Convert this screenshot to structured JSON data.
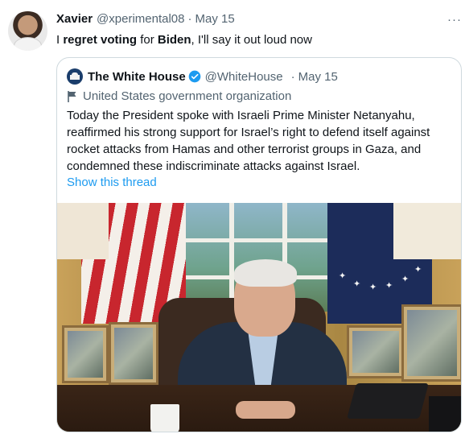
{
  "tweet": {
    "author_name": "Xavier",
    "author_handle": "@xperimental08",
    "separator": "·",
    "date": "May 15",
    "more_label": "···",
    "text_parts": [
      "I ",
      "regret voting",
      " for ",
      "Biden",
      ", I'll say it out loud now"
    ]
  },
  "quote": {
    "author_name": "The White House",
    "author_handle": "@WhiteHouse",
    "separator": "·",
    "date": "May 15",
    "org_label": "United States government organization",
    "text_lines": [
      "Today the President spoke with Israeli Prime Minister Netanyahu,",
      "reaffirmed his strong support for Israel’s right to defend itself against",
      "rocket attacks from Hamas and other terrorist groups in Gaza, and",
      "condemned these indiscriminate attacks against Israel."
    ],
    "show_thread": "Show this thread"
  },
  "colors": {
    "link": "#1d9bf0",
    "secondary_text": "#536471",
    "border": "#cfd9de"
  },
  "icons": [
    "avatar",
    "white-house-logo",
    "verified-badge-icon",
    "government-flag-icon",
    "more-options-icon"
  ]
}
